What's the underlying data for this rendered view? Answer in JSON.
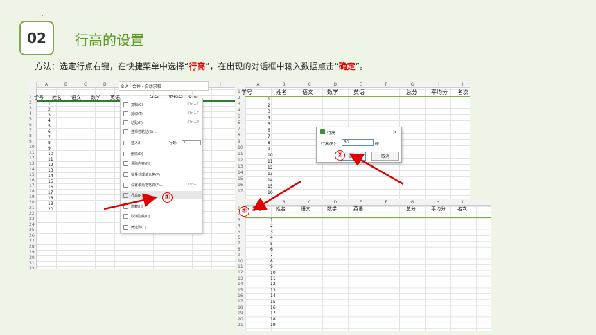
{
  "header": {
    "number": "02",
    "title": "行高的设置"
  },
  "instruction": {
    "prefix": "方法：选定行点右键，在快捷菜单中选择“",
    "highlight1": "行高",
    "middle": "”，在出现的对话框中输入数据点击“",
    "highlight2": "确定",
    "suffix": "”。"
  },
  "shot1": {
    "columns": [
      "A",
      "B",
      "C",
      "D",
      "E",
      "F",
      "G",
      "H",
      "I",
      "J"
    ],
    "headers": [
      "学号",
      "姓名",
      "语文",
      "数学",
      "英语",
      "总分",
      "平均分",
      "名次"
    ],
    "toolbar_text": "B A · 合并 · 自动求和",
    "menu": [
      {
        "label": "复制(C)",
        "shortcut": "Ctrl+C"
      },
      {
        "label": "剪切(T)",
        "shortcut": "Ctrl+X"
      },
      {
        "label": "粘贴(P)",
        "shortcut": "Ctrl+V"
      },
      {
        "label": "选择性粘贴(S)...",
        "shortcut": ""
      },
      {
        "label": "插入(I)",
        "shortcut": ""
      },
      {
        "label": "删除(D)",
        "shortcut": ""
      },
      {
        "label": "清除内容(N)",
        "shortcut": ""
      },
      {
        "label": "批量处理单元格(P)",
        "shortcut": ""
      },
      {
        "label": "设置单元格格式(F)...",
        "shortcut": "Ctrl+1"
      },
      {
        "label": "行高(R)...",
        "shortcut": ""
      },
      {
        "label": "隐藏(H)",
        "shortcut": ""
      },
      {
        "label": "取消隐藏(U)",
        "shortcut": ""
      },
      {
        "label": "筛选列(L)",
        "shortcut": ""
      }
    ],
    "insert_rows_label": "行数:",
    "insert_rows_value": "1",
    "marker": "①"
  },
  "shot2": {
    "columns": [
      "A",
      "B",
      "C",
      "D",
      "E",
      "F",
      "G",
      "H",
      "I"
    ],
    "headers": [
      "学号",
      "姓名",
      "语文",
      "数学",
      "英语",
      "总分",
      "平均分",
      "名次"
    ],
    "dialog": {
      "title": "行高",
      "label": "行高(R):",
      "value": "30",
      "unit": "磅",
      "ok": "确定",
      "cancel": "取消"
    },
    "marker": "②"
  },
  "shot3": {
    "columns": [
      "A",
      "B",
      "C",
      "D",
      "E",
      "F",
      "G",
      "H",
      "I"
    ],
    "headers": [
      "学号",
      "姓名",
      "语文",
      "数学",
      "英语",
      "总分",
      "平均分",
      "名次"
    ],
    "marker": "③"
  },
  "colors": {
    "accent_green": "#5e9a2a",
    "highlight_red": "#e00000",
    "arrow_red": "#e00000",
    "background": "#eef4e6"
  }
}
